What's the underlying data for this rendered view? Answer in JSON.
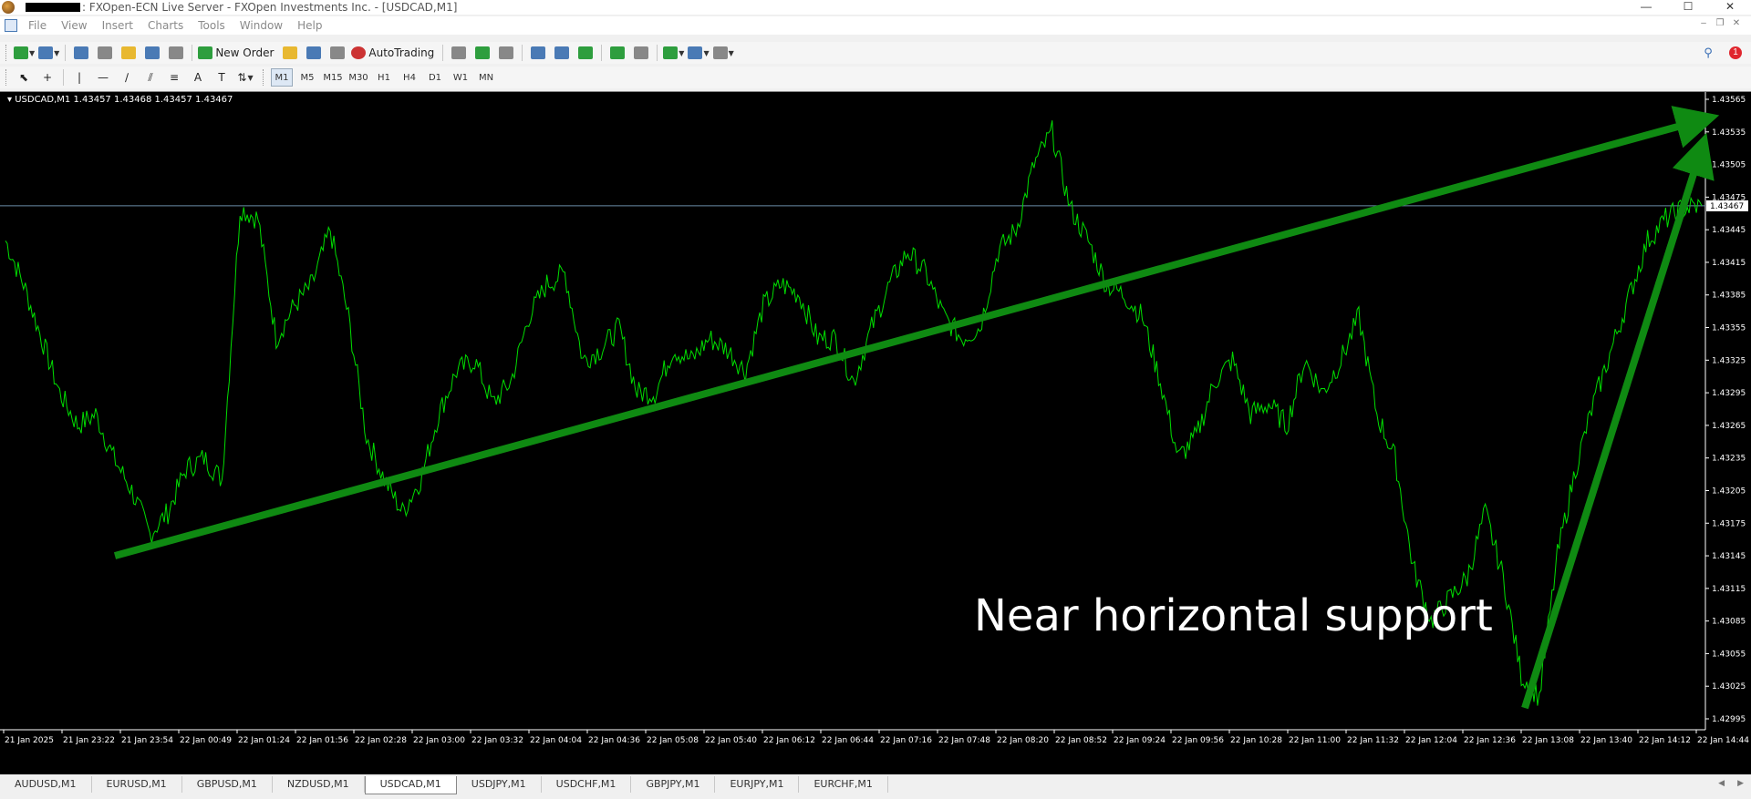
{
  "window": {
    "title": ": FXOpen-ECN Live Server - FXOpen Investments Inc. - [USDCAD,M1]",
    "controls": [
      "—",
      "☐",
      "✕"
    ]
  },
  "menu": [
    "File",
    "View",
    "Insert",
    "Charts",
    "Tools",
    "Window",
    "Help"
  ],
  "toolbar": {
    "new_order_label": "New Order",
    "autotrading_label": "AutoTrading",
    "notification_count": "1"
  },
  "periods": [
    "M1",
    "M5",
    "M15",
    "M30",
    "H1",
    "H4",
    "D1",
    "W1",
    "MN"
  ],
  "active_period": "M1",
  "chart": {
    "header": "USDCAD,M1  1.43457 1.43468 1.43457 1.43467",
    "current_price_label": "1.43467",
    "annotation": "Near horizontal support",
    "colors": {
      "background": "#000000",
      "price_line": "#00dd00",
      "arrows": "#0f8a12",
      "current_price_line": "#6a8ca8"
    }
  },
  "chart_data": {
    "type": "line",
    "symbol": "USDCAD",
    "timeframe": "M1",
    "y_ticks": [
      "1.43565",
      "1.43535",
      "1.43505",
      "1.43475",
      "1.43445",
      "1.43415",
      "1.43385",
      "1.43355",
      "1.43325",
      "1.43295",
      "1.43265",
      "1.43235",
      "1.43205",
      "1.43175",
      "1.43145",
      "1.43115",
      "1.43085",
      "1.43055",
      "1.43025",
      "1.42995"
    ],
    "ylim": [
      1.42995,
      1.43565
    ],
    "x_ticks": [
      "21 Jan 2025",
      "21 Jan 23:22",
      "21 Jan 23:54",
      "22 Jan 00:49",
      "22 Jan 01:24",
      "22 Jan 01:56",
      "22 Jan 02:28",
      "22 Jan 03:00",
      "22 Jan 03:32",
      "22 Jan 04:04",
      "22 Jan 04:36",
      "22 Jan 05:08",
      "22 Jan 05:40",
      "22 Jan 06:12",
      "22 Jan 06:44",
      "22 Jan 07:16",
      "22 Jan 07:48",
      "22 Jan 08:20",
      "22 Jan 08:52",
      "22 Jan 09:24",
      "22 Jan 09:56",
      "22 Jan 10:28",
      "22 Jan 11:00",
      "22 Jan 11:32",
      "22 Jan 12:04",
      "22 Jan 12:36",
      "22 Jan 13:08",
      "22 Jan 13:40",
      "22 Jan 14:12",
      "22 Jan 14:44"
    ],
    "current_price": 1.43467,
    "series": [
      {
        "values": [
          1.43435,
          1.43395,
          1.43345,
          1.43295,
          1.43265,
          1.43275,
          1.43235,
          1.43205,
          1.43165,
          1.43185,
          1.43225,
          1.43235,
          1.43215,
          1.43465,
          1.43455,
          1.43345,
          1.43375,
          1.43395,
          1.43445,
          1.43365,
          1.43255,
          1.43215,
          1.43185,
          1.43215,
          1.43275,
          1.43315,
          1.43325,
          1.43285,
          1.43305,
          1.43365,
          1.43395,
          1.43405,
          1.43325,
          1.43335,
          1.43355,
          1.43295,
          1.43295,
          1.43335,
          1.43325,
          1.43345,
          1.43335,
          1.43315,
          1.43375,
          1.43395,
          1.43385,
          1.43345,
          1.43345,
          1.43305,
          1.43355,
          1.43395,
          1.43425,
          1.43405,
          1.43365,
          1.43345,
          1.43355,
          1.43425,
          1.43445,
          1.43505,
          1.43535,
          1.43465,
          1.43435,
          1.43395,
          1.43385,
          1.43365,
          1.43305,
          1.43235,
          1.43255,
          1.43305,
          1.43325,
          1.43275,
          1.43285,
          1.43265,
          1.43325,
          1.43295,
          1.43325,
          1.43365,
          1.43275,
          1.43235,
          1.43135,
          1.43085,
          1.43105,
          1.43125,
          1.43185,
          1.43125,
          1.43035,
          1.43015,
          1.43145,
          1.43225,
          1.43285,
          1.43335,
          1.43385,
          1.43435,
          1.43455,
          1.43465,
          1.43467
        ]
      }
    ],
    "annotations": [
      {
        "type": "arrow",
        "from": {
          "x": "21 Jan 23:54",
          "y": 1.43145
        },
        "to": {
          "x": "22 Jan 14:44",
          "y": 1.43545
        }
      },
      {
        "type": "arrow",
        "from": {
          "x": "22 Jan 13:08",
          "y": 1.43005
        },
        "to": {
          "x": "22 Jan 14:44",
          "y": 1.43515
        }
      },
      {
        "type": "text",
        "text": "Near horizontal support"
      }
    ]
  },
  "symbol_tabs": [
    "AUDUSD,M1",
    "EURUSD,M1",
    "GBPUSD,M1",
    "NZDUSD,M1",
    "USDCAD,M1",
    "USDJPY,M1",
    "USDCHF,M1",
    "GBPJPY,M1",
    "EURJPY,M1",
    "EURCHF,M1"
  ],
  "active_tab": "USDCAD,M1"
}
